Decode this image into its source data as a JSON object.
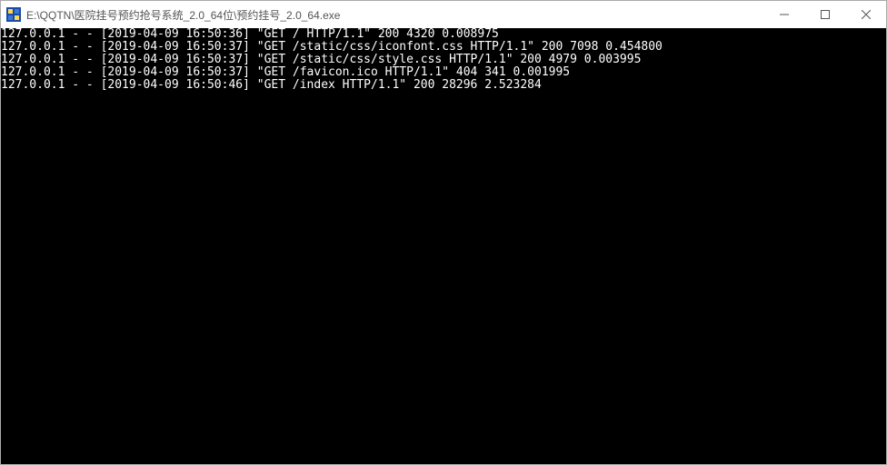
{
  "window": {
    "title": "E:\\QQTN\\医院挂号预约抢号系统_2.0_64位\\预约挂号_2.0_64.exe"
  },
  "controls": {
    "minimize": "—",
    "maximize": "☐",
    "close": "✕"
  },
  "log_lines": [
    "127.0.0.1 - - [2019-04-09 16:50:36] \"GET / HTTP/1.1\" 200 4320 0.008975",
    "127.0.0.1 - - [2019-04-09 16:50:37] \"GET /static/css/iconfont.css HTTP/1.1\" 200 7098 0.454800",
    "127.0.0.1 - - [2019-04-09 16:50:37] \"GET /static/css/style.css HTTP/1.1\" 200 4979 0.003995",
    "127.0.0.1 - - [2019-04-09 16:50:37] \"GET /favicon.ico HTTP/1.1\" 404 341 0.001995",
    "127.0.0.1 - - [2019-04-09 16:50:46] \"GET /index HTTP/1.1\" 200 28296 2.523284"
  ]
}
